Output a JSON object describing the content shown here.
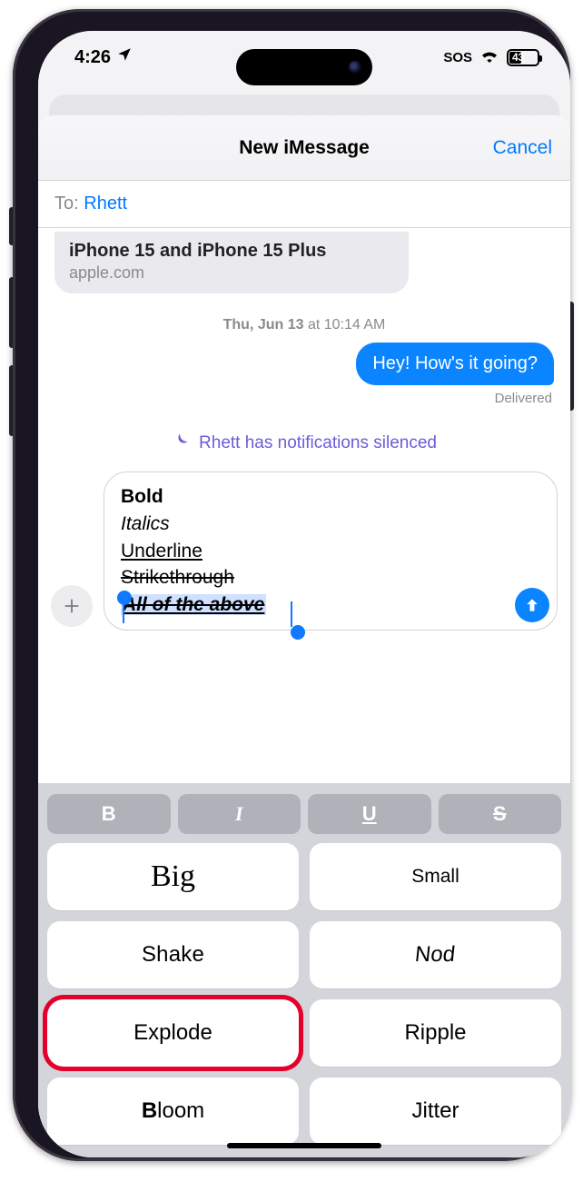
{
  "status": {
    "time": "4:26",
    "sos": "SOS",
    "battery_pct": "43"
  },
  "nav": {
    "title": "New iMessage",
    "cancel": "Cancel"
  },
  "to": {
    "label": "To:",
    "name": "Rhett"
  },
  "link_preview": {
    "title": "iPhone 15 and iPhone 15 Plus",
    "domain": "apple.com"
  },
  "timestamp": {
    "day": "Thu, Jun 13",
    "at": " at ",
    "time": "10:14 AM"
  },
  "bubble_out": "Hey! How's it going?",
  "delivered": "Delivered",
  "silenced": "Rhett has notifications silenced",
  "compose": {
    "line1": "Bold",
    "line2": "Italics",
    "line3": "Underline",
    "line4": "Strikethrough",
    "line5": "All of the above"
  },
  "format_buttons": {
    "bold": "B",
    "italic": "I",
    "underline": "U",
    "strike": "S"
  },
  "effects": {
    "big": "Big",
    "small": "Small",
    "shake": "Shake",
    "nod": "Nod",
    "explode": "Explode",
    "ripple": "Ripple",
    "bloom_b": "B",
    "bloom_rest": "loom",
    "jitter": "Jitter"
  }
}
